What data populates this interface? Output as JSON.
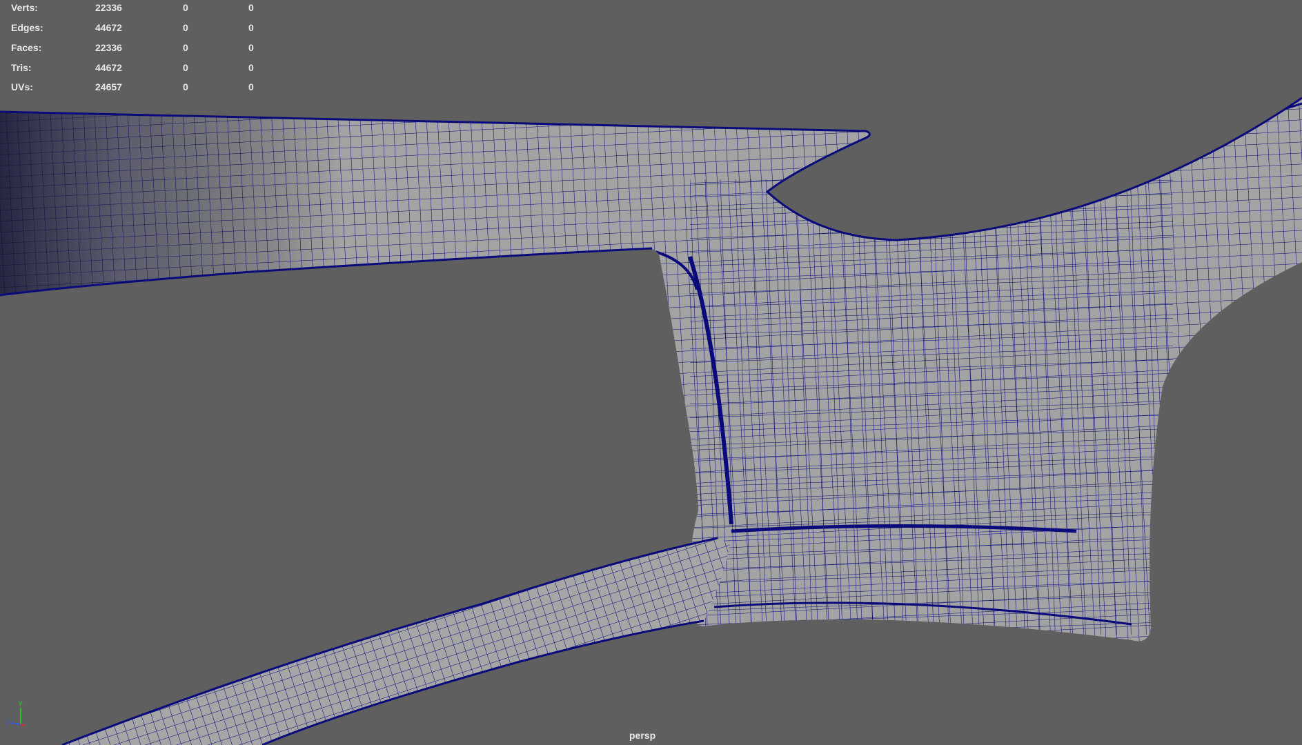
{
  "hud": {
    "rows": [
      {
        "label": "Verts:",
        "total": "22336",
        "selected": "0",
        "selected2": "0"
      },
      {
        "label": "Edges:",
        "total": "44672",
        "selected": "0",
        "selected2": "0"
      },
      {
        "label": "Faces:",
        "total": "22336",
        "selected": "0",
        "selected2": "0"
      },
      {
        "label": "Tris:",
        "total": "44672",
        "selected": "0",
        "selected2": "0"
      },
      {
        "label": "UVs:",
        "total": "24657",
        "selected": "0",
        "selected2": "0"
      }
    ]
  },
  "viewport": {
    "camera": "persp",
    "background": "#5f5f5f",
    "mesh_fill": "#a4a4a4",
    "wire_color": "#0a0a7a"
  },
  "axis": {
    "y": "y",
    "z": "z",
    "x_color": "#d23232",
    "y_color": "#2ec02e",
    "z_color": "#3a5bd8"
  }
}
